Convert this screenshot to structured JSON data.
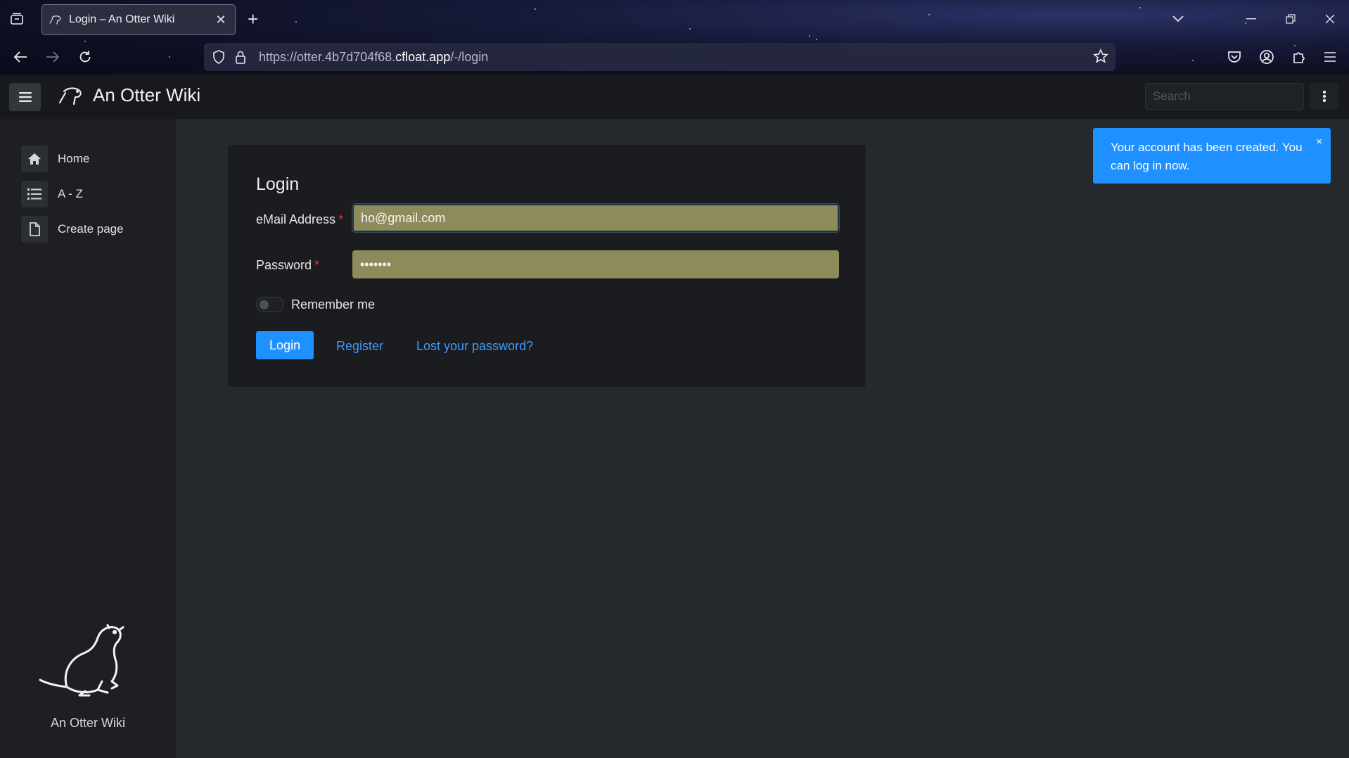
{
  "browser": {
    "tab_title": "Login – An Otter Wiki",
    "url_prefix": "https://otter.4b7d704f68.",
    "url_host": "cfloat.app",
    "url_path": "/-/login"
  },
  "header": {
    "brand": "An Otter Wiki",
    "search_placeholder": "Search"
  },
  "sidebar": {
    "items": [
      {
        "label": "Home",
        "icon": "home-icon"
      },
      {
        "label": "A - Z",
        "icon": "list-icon"
      },
      {
        "label": "Create page",
        "icon": "file-icon"
      }
    ],
    "footer_label": "An Otter Wiki"
  },
  "login": {
    "title": "Login",
    "email_label": "eMail Address",
    "email_value": "ho@gmail.com",
    "password_label": "Password",
    "password_value": "•••••••",
    "required_mark": "*",
    "remember_label": "Remember me",
    "submit_label": "Login",
    "register_link": "Register",
    "lost_password_link": "Lost your password?"
  },
  "toast": {
    "message": "Your account has been created. You can log in now.",
    "close": "×"
  },
  "colors": {
    "accent": "#1e90ff",
    "autofill": "#8d8b5c",
    "required": "#dc3545"
  }
}
